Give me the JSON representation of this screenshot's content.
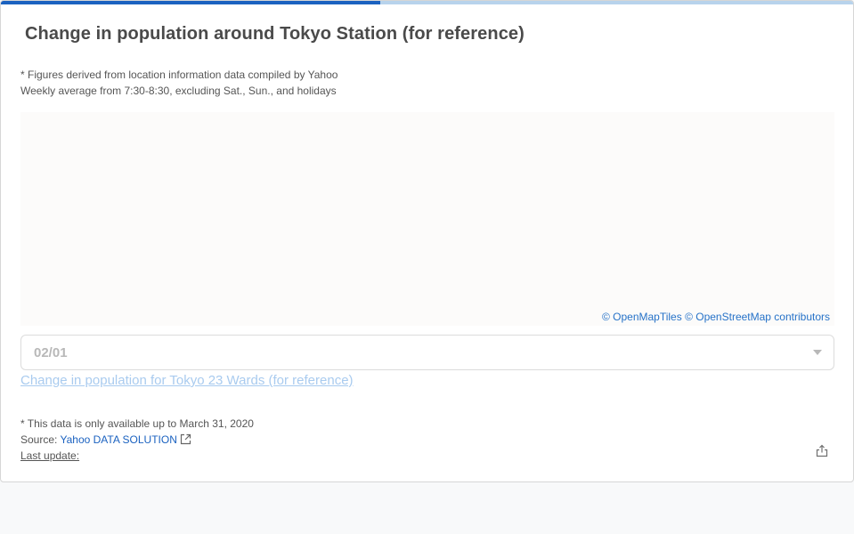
{
  "progress": {
    "fraction": 0.445,
    "fill_color": "#1b62c0",
    "track_color": "#b8d3ec"
  },
  "card": {
    "title": "Change in population around Tokyo Station (for reference)",
    "notes": [
      "* Figures derived from location information data compiled by Yahoo",
      "Weekly average from 7:30-8:30, excluding Sat., Sun., and holidays"
    ]
  },
  "map": {
    "attribution": {
      "openmaptiles": "© OpenMapTiles",
      "openstreetmap": "© OpenStreetMap contributors"
    }
  },
  "date_select": {
    "value": "02/01",
    "icon": "chevron-down-icon"
  },
  "other_link": "Change in population for Tokyo 23 Wards (for reference)",
  "footer": {
    "availability_note": "* This data is only available up to March 31, 2020",
    "source_label": "Source:",
    "source_link": "Yahoo DATA SOLUTION",
    "source_icon": "external-link-icon",
    "last_update_label": "Last update:"
  },
  "share_icon": "share-icon"
}
